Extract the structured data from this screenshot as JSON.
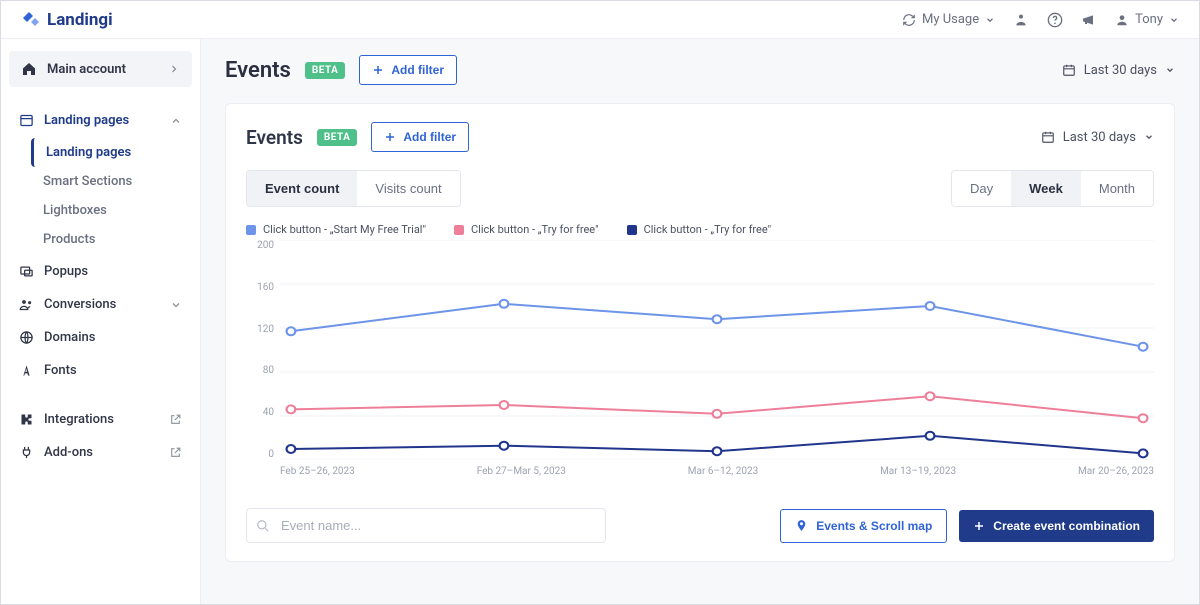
{
  "brand": "Landingi",
  "topbar": {
    "usage": "My Usage",
    "user": "Tony"
  },
  "sidebar": {
    "account": "Main account",
    "items": [
      {
        "label": "Landing pages",
        "icon": "window",
        "active": true,
        "expandable": true
      },
      {
        "label": "Popups",
        "icon": "popup"
      },
      {
        "label": "Conversions",
        "icon": "people",
        "expandable": true
      },
      {
        "label": "Domains",
        "icon": "globe"
      },
      {
        "label": "Fonts",
        "icon": "font"
      },
      {
        "label": "Integrations",
        "icon": "puzzle",
        "ext": true
      },
      {
        "label": "Add-ons",
        "icon": "plug",
        "ext": true
      }
    ],
    "sub": [
      {
        "label": "Landing pages",
        "active": true
      },
      {
        "label": "Smart Sections"
      },
      {
        "label": "Lightboxes"
      },
      {
        "label": "Products"
      }
    ]
  },
  "page": {
    "title": "Events",
    "beta": "BETA",
    "add_filter": "Add filter",
    "date_range": "Last 30 days"
  },
  "inner": {
    "title": "Events",
    "beta": "BETA",
    "add_filter": "Add filter",
    "date_range": "Last 30 days",
    "tabs": {
      "event_count": "Event count",
      "visits_count": "Visits count"
    },
    "range": {
      "day": "Day",
      "week": "Week",
      "month": "Month"
    },
    "legend": [
      {
        "label": "Click button - „Start My Free Trial\"",
        "color": "#6d94e8"
      },
      {
        "label": "Click button - „Try for free\"",
        "color": "#ee7f9a"
      },
      {
        "label": "Click button - „Try for free\"",
        "color": "#21358d"
      }
    ],
    "search_placeholder": "Event name...",
    "maps_btn": "Events & Scroll map",
    "create_btn": "Create event combination"
  },
  "chart_data": {
    "type": "line",
    "xlabel": "",
    "ylabel": "",
    "ylim": [
      0,
      200
    ],
    "yticks": [
      200,
      160,
      120,
      80,
      40,
      0
    ],
    "categories": [
      "Feb 25–26, 2023",
      "Feb 27–Mar 5, 2023",
      "Mar 6–12, 2023",
      "Mar 13–19, 2023",
      "Mar 20–26, 2023"
    ],
    "series": [
      {
        "name": "Click button - „Start My Free Trial\"",
        "color": "#6d94e8",
        "values": [
          117,
          142,
          128,
          140,
          103
        ]
      },
      {
        "name": "Click button - „Try for free\"",
        "color": "#ee7f9a",
        "values": [
          46,
          50,
          42,
          58,
          38
        ]
      },
      {
        "name": "Click button - „Try for free\"",
        "color": "#21358d",
        "values": [
          10,
          13,
          8,
          22,
          6
        ]
      }
    ]
  }
}
